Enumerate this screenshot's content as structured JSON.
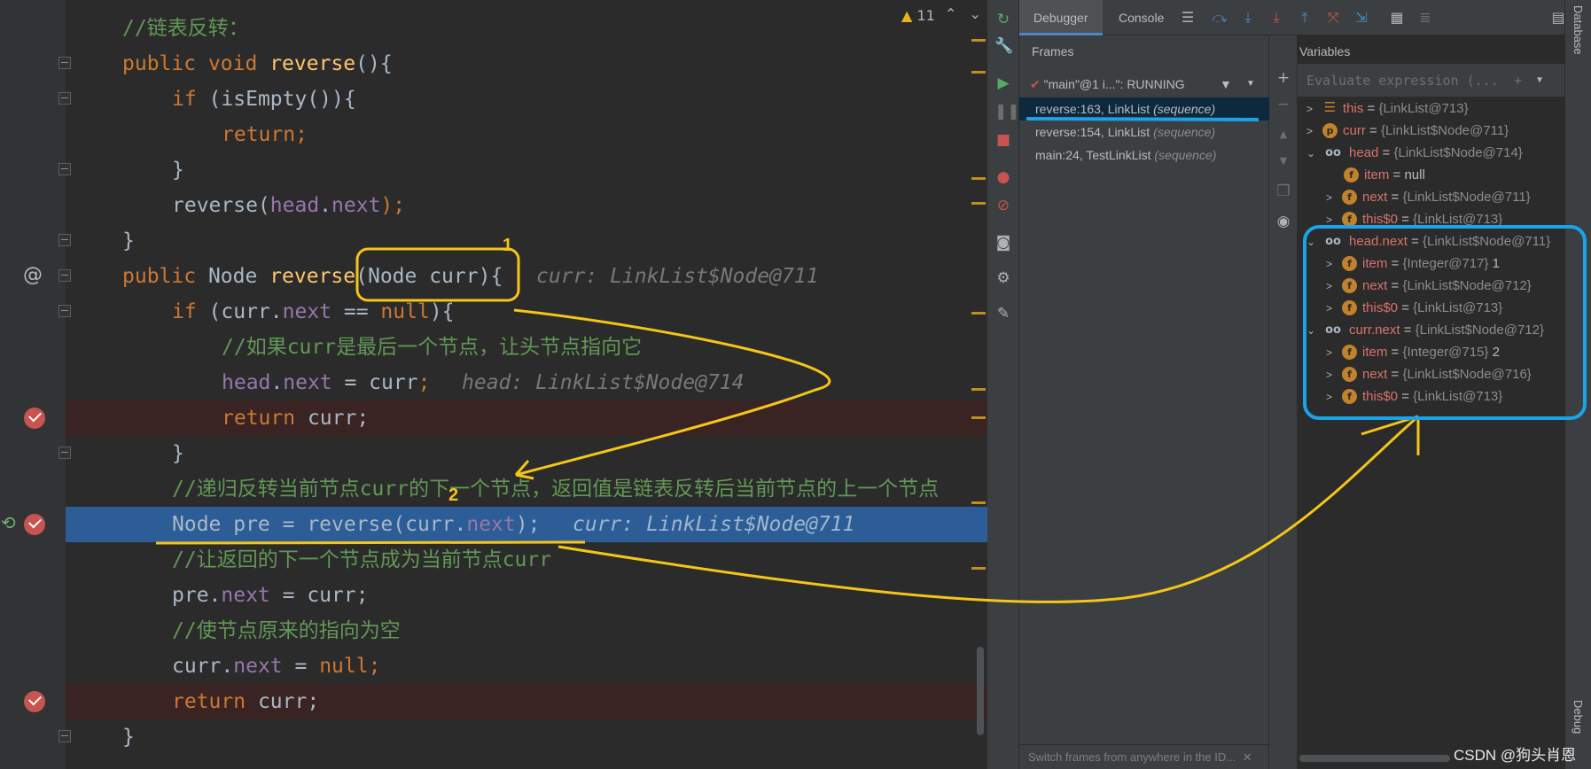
{
  "editor": {
    "warnings": "11",
    "lines": [
      {
        "comment": "//链表反转："
      },
      {
        "kw1": "public",
        "kw2": "void",
        "fn": "reverse",
        "rest": "(){"
      },
      {
        "kw": "if",
        "rest": " (isEmpty()){"
      },
      {
        "kw": "return",
        "rest": ";"
      },
      {
        "text": "}"
      },
      {
        "pre": "reverse(",
        "fld1": "head",
        "dot": ".",
        "fld2": "next",
        "post": ");"
      },
      {
        "text": "}"
      },
      {
        "kw1": "public",
        "type": " Node ",
        "fn": "reverse",
        "params": "(Node curr){",
        "hint": "curr: LinkList$Node@711"
      },
      {
        "kw": "if",
        "pre": " (curr.",
        "fld": "next",
        "mid": " == ",
        "kw2": "null",
        "post": "){"
      },
      {
        "comment": "//如果curr是最后一个节点，让头节点指向它"
      },
      {
        "fld1": "head",
        "dot": ".",
        "fld2": "next",
        "mid": " = curr",
        "semi": ";",
        "hint": "head: LinkList$Node@714"
      },
      {
        "kw": "return",
        "rest": " curr;"
      },
      {
        "text": "}"
      },
      {
        "comment": "//递归反转当前节点curr的下一个节点，返回值是链表反转后当前节点的上一个节点"
      },
      {
        "pre": "Node pre = reverse(curr.",
        "fld": "next",
        "post": ");",
        "hint": "curr: LinkList$Node@711"
      },
      {
        "comment": "//让返回的下一个节点成为当前节点curr"
      },
      {
        "pre": "pre.",
        "fld": "next",
        "post": " = curr;"
      },
      {
        "comment": "//使节点原来的指向为空"
      },
      {
        "pre": "curr.",
        "fld": "next",
        "mid": " = ",
        "kw": "null",
        "post": ";"
      },
      {
        "kw": "return",
        "rest": " curr;"
      },
      {
        "text": "}"
      }
    ]
  },
  "debugger": {
    "tabs": [
      "Debugger",
      "Console"
    ],
    "frames_title": "Frames",
    "variables_title": "Variables",
    "thread": "\"main\"@1 i...\": RUNNING",
    "frames": [
      {
        "method": "reverse:163, LinkList",
        "tag": "(sequence)"
      },
      {
        "method": "reverse:154, LinkList",
        "tag": "(sequence)"
      },
      {
        "method": "main:24, TestLinkList",
        "tag": "(sequence)"
      }
    ],
    "frames_footer": "Switch frames from anywhere in the ID...",
    "eval_placeholder": "Evaluate expression (...",
    "variables": [
      {
        "name": "this",
        "value": "{LinkList@713}"
      },
      {
        "name": "curr",
        "value": "{LinkList$Node@711}"
      },
      {
        "name": "head",
        "value": "{LinkList$Node@714}"
      },
      {
        "name": "item",
        "value": "null"
      },
      {
        "name": "next",
        "value": "{LinkList$Node@711}"
      },
      {
        "name": "this$0",
        "value": "{LinkList@713}"
      },
      {
        "name": "head.next",
        "value": "{LinkList$Node@711}"
      },
      {
        "name": "item",
        "value": "{Integer@717}",
        "extra": "1"
      },
      {
        "name": "next",
        "value": "{LinkList$Node@712}"
      },
      {
        "name": "this$0",
        "value": "{LinkList@713}"
      },
      {
        "name": "curr.next",
        "value": "{LinkList$Node@712}"
      },
      {
        "name": "item",
        "value": "{Integer@715}",
        "extra": "2"
      },
      {
        "name": "next",
        "value": "{LinkList$Node@716}"
      },
      {
        "name": "this$0",
        "value": "{LinkList@713}"
      }
    ],
    "side_labels": {
      "database": "Database",
      "debug": "Debug"
    }
  },
  "annotations": {
    "one": "1",
    "two": "2"
  },
  "watermark": "CSDN @狗头肖恩",
  "colors": {
    "highlight": "#f5c518",
    "box": "#1aa3e8",
    "exec_line": "#2d5d96",
    "breakpoint": "#c75450"
  }
}
